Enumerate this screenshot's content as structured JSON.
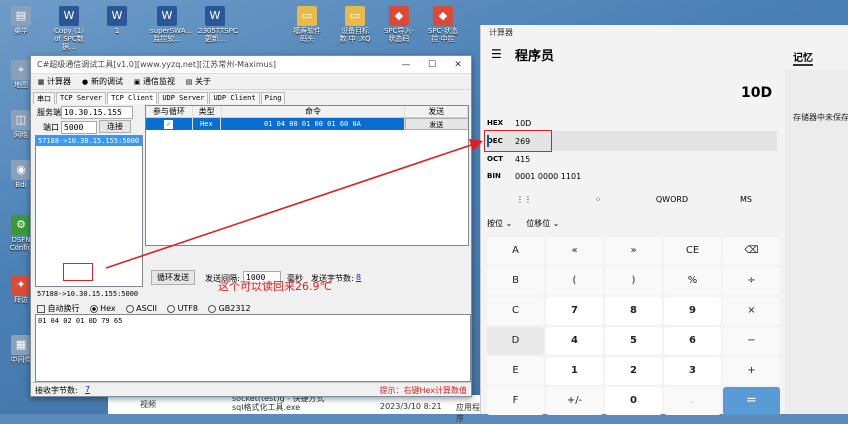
{
  "desktop": {
    "icons": [
      "桌华",
      "Copy (1) of SPC数据...",
      "1",
      "superSWA...监控软...",
      "2305TTSPC 更新...",
      "福寿软件码头",
      "设备目标数 中 .XQ",
      "SPC导入-状态码",
      "SPC-状态控 中控",
      "甲程",
      "地图",
      "拜访",
      "RAB",
      "网络",
      "Bdi",
      "DSFN Config",
      "中间件",
      "记事"
    ],
    "taskbar_items": [
      "视频",
      "socket(test)g - 快捷方式",
      "sql格式化工具.exe",
      "2023/3/10 8:21",
      "应用程序"
    ]
  },
  "tool": {
    "title": "C#超级通信调试工具[v1.0][www.yyzq.net][江苏常州-Maximus]",
    "menu": [
      "计算器",
      "新的调试",
      "通信监视",
      "关于"
    ],
    "tabs": [
      "串口",
      "TCP Server",
      "TCP Client",
      "UDP Server",
      "UDP Client",
      "Ping"
    ],
    "server_addr_label": "服务端",
    "server_addr": "10.30.15.155",
    "port_label": "端口",
    "port": "5000",
    "connect_label": "连接",
    "connections": [
      "57188->10.30.15.155:5000"
    ],
    "grid_headers": [
      "参与循环",
      "类型",
      "命令",
      "发送"
    ],
    "grid_row": {
      "checked": true,
      "type": "Hex",
      "command": "01 04 00 01 00 01 60 0A",
      "send": "发送"
    },
    "loop_send_label": "循环发送",
    "interval_label": "发送间隔:",
    "interval": "1000",
    "ms_label": "毫秒",
    "send_bytes_label": "发送字节数:",
    "send_bytes": "8",
    "status_conn": "57188->10.30.15.155:5000",
    "auto_wrap_label": "自动换行",
    "encodings": [
      "Hex",
      "ASCII",
      "UTF8",
      "GB2312"
    ],
    "received": "01 04 02 01 0D 79 65",
    "recv_bytes_label": "接收字节数:",
    "recv_bytes": "7",
    "tip": "提示：右键Hex计算数值"
  },
  "calculator": {
    "window_title": "计算器",
    "mode": "程序员",
    "memory_tab": "记忆",
    "memory_empty": "存储器中未保存",
    "display": "10D",
    "radix": [
      {
        "key": "HEX",
        "value": "10D"
      },
      {
        "key": "DEC",
        "value": "269"
      },
      {
        "key": "OCT",
        "value": "415"
      },
      {
        "key": "BIN",
        "value": "0001 0000 1101"
      }
    ],
    "word_row": [
      "⋮⋮",
      "⁘",
      "QWORD",
      "MS"
    ],
    "bit_row": [
      "按位 ⌄",
      "位移位 ⌄"
    ],
    "keys": [
      [
        "A",
        "«",
        "»",
        "CE",
        "⌫"
      ],
      [
        "B",
        "(",
        ")",
        "%",
        "÷"
      ],
      [
        "C",
        "7",
        "8",
        "9",
        "×"
      ],
      [
        "D",
        "4",
        "5",
        "6",
        "−"
      ],
      [
        "E",
        "1",
        "2",
        "3",
        "+"
      ],
      [
        "F",
        "+/-",
        "0",
        ".",
        "="
      ]
    ]
  },
  "annotation": "这个可以读回来26.9℃",
  "colors": {
    "accent": "#0a6ed1",
    "annotation": "#e02020",
    "equals": "#5a9bd5"
  }
}
